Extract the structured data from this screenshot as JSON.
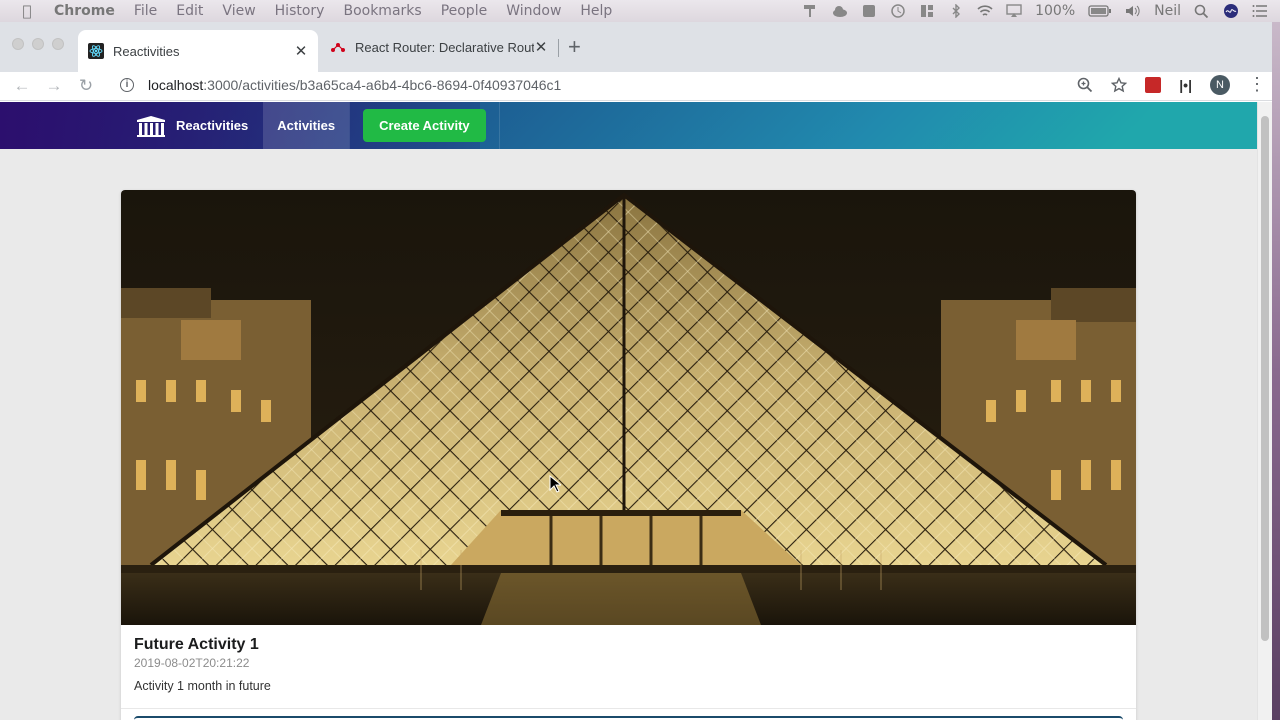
{
  "os_menubar": {
    "app_name": "Chrome",
    "menus": [
      "File",
      "Edit",
      "View",
      "History",
      "Bookmarks",
      "People",
      "Window",
      "Help"
    ],
    "battery": "100%",
    "user": "Neil"
  },
  "browser": {
    "tabs": [
      {
        "title": "Reactivities",
        "active": true
      },
      {
        "title": "React Router: Declarative Routing",
        "active": false
      }
    ],
    "url_host": "localhost",
    "url_path": ":3000/activities/b3a65ca4-a6b4-4bc6-8694-0f40937046c1",
    "profile_initial": "N"
  },
  "app": {
    "brand": "Reactivities",
    "nav_activities": "Activities",
    "create_button": "Create Activity",
    "accent_color": "#21ba45"
  },
  "activity": {
    "title": "Future Activity 1",
    "date": "2019-08-02T20:21:22",
    "description": "Activity 1 month in future"
  }
}
